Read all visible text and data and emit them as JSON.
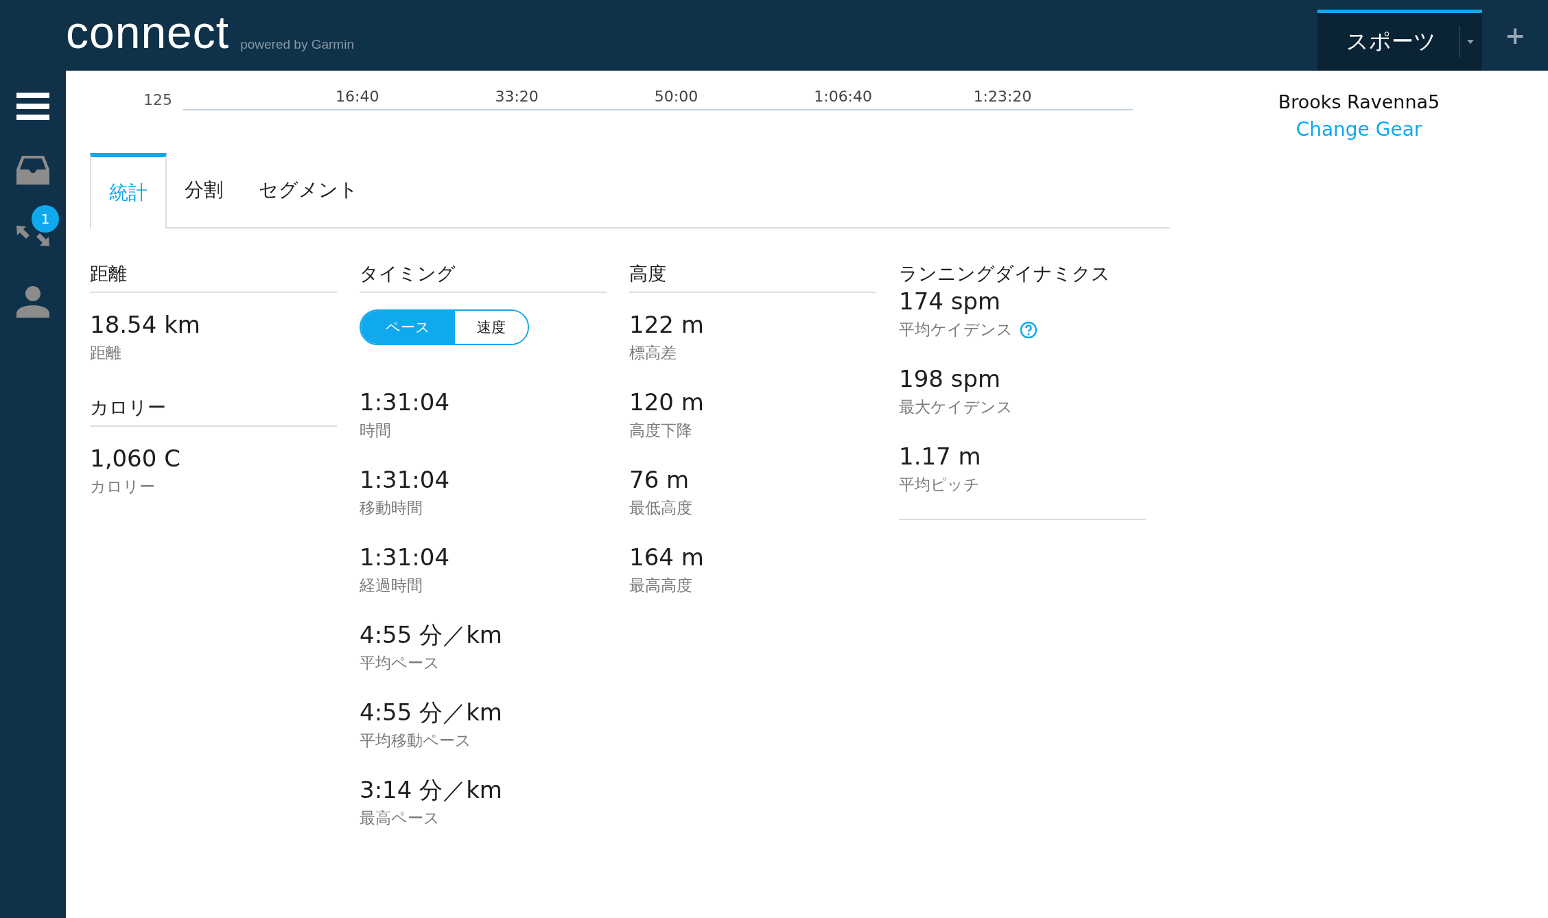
{
  "header": {
    "logo": "connect",
    "tagline": "powered by Garmin",
    "sport_menu": "スポーツ",
    "add_button": "+"
  },
  "sidebar": {
    "badge": "1"
  },
  "chart_axis": {
    "y_label": "125",
    "x_labels": [
      "16:40",
      "33:20",
      "50:00",
      "1:06:40",
      "1:23:20"
    ]
  },
  "gear": {
    "name": "Brooks Ravenna5",
    "link": "Change Gear"
  },
  "tabs": [
    {
      "label": "統計",
      "selected": true
    },
    {
      "label": "分割",
      "selected": false
    },
    {
      "label": "セグメント",
      "selected": false
    }
  ],
  "columns": [
    {
      "sections": [
        {
          "heading": "距離",
          "stats": [
            {
              "value": "18.54 km",
              "label": "距離"
            }
          ]
        },
        {
          "heading": "カロリー",
          "stats": [
            {
              "value": "1,060 C",
              "label": "カロリー"
            }
          ]
        }
      ]
    },
    {
      "sections": [
        {
          "heading": "タイミング",
          "toggle": [
            {
              "label": "ペース",
              "selected": true
            },
            {
              "label": "速度",
              "selected": false
            }
          ],
          "stats": [
            {
              "value": "1:31:04",
              "label": "時間"
            },
            {
              "value": "1:31:04",
              "label": "移動時間"
            },
            {
              "value": "1:31:04",
              "label": "経過時間"
            },
            {
              "value": "4:55 分／km",
              "label": "平均ペース"
            },
            {
              "value": "4:55 分／km",
              "label": "平均移動ペース"
            },
            {
              "value": "3:14 分／km",
              "label": "最高ペース"
            }
          ]
        }
      ]
    },
    {
      "sections": [
        {
          "heading": "高度",
          "stats": [
            {
              "value": "122 m",
              "label": "標高差"
            },
            {
              "value": "120 m",
              "label": "高度下降"
            },
            {
              "value": "76 m",
              "label": "最低高度"
            },
            {
              "value": "164 m",
              "label": "最高高度"
            }
          ]
        }
      ]
    },
    {
      "sections": [
        {
          "heading": "ランニングダイナミクス",
          "compact": true,
          "stats": [
            {
              "value": "174 spm",
              "label": "平均ケイデンス",
              "help": true
            },
            {
              "value": "198 spm",
              "label": "最大ケイデンス"
            },
            {
              "value": "1.17 m",
              "label": "平均ピッチ"
            }
          ]
        }
      ]
    }
  ]
}
